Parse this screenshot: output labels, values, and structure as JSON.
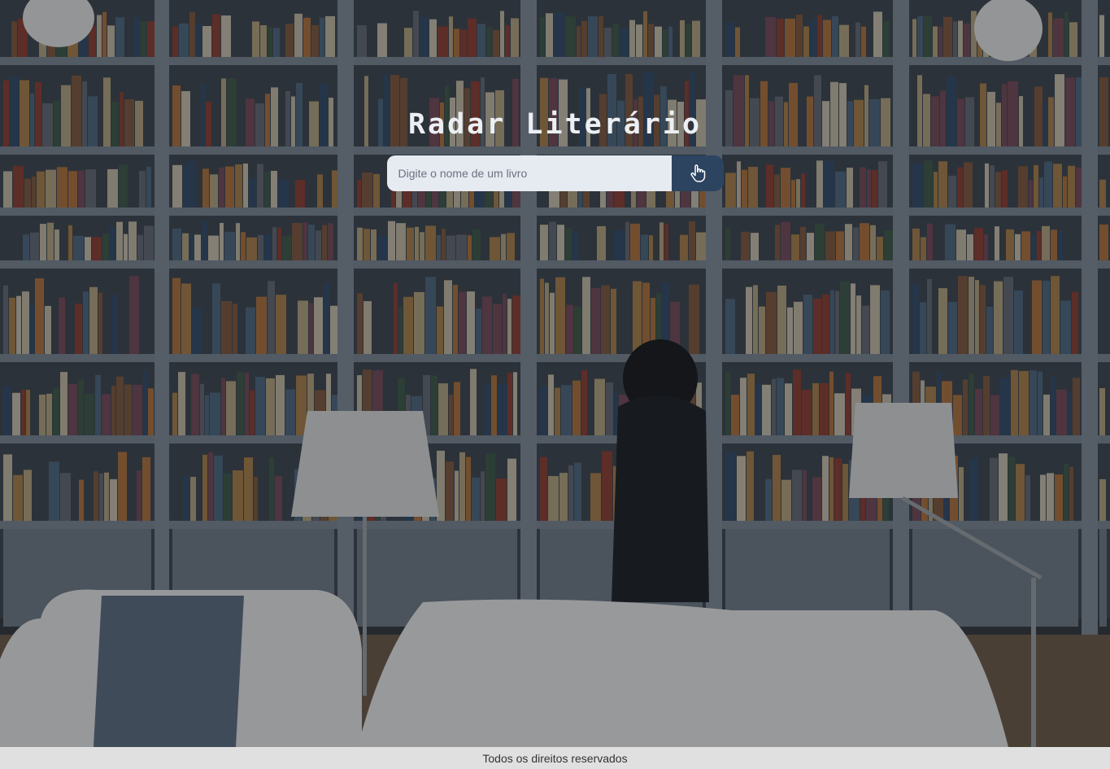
{
  "header": {
    "title": "Radar Literário"
  },
  "search": {
    "placeholder": "Digite o nome de um livro",
    "value": "",
    "button_icon": "hand-pointer-icon"
  },
  "background": {
    "description_icon": "bookshelf-photo"
  },
  "footer": {
    "text": "Todos os direitos reservados"
  },
  "colors": {
    "button_bg": "#2c4460",
    "input_bg": "#e6eaf1",
    "footer_bg": "#e0e0e0",
    "title": "#eceff3"
  }
}
